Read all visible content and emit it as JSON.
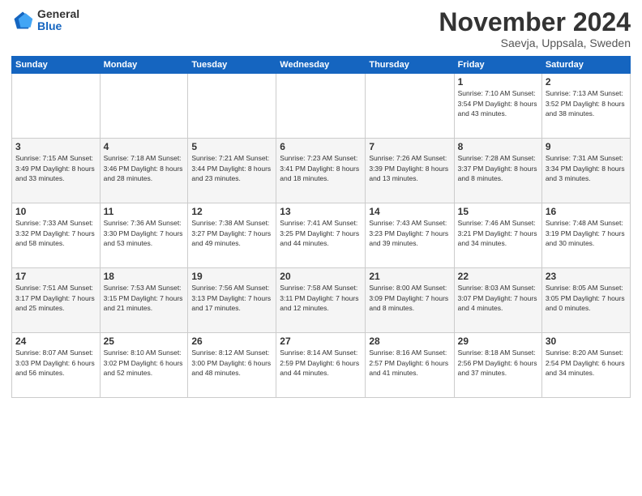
{
  "header": {
    "logo_general": "General",
    "logo_blue": "Blue",
    "month_title": "November 2024",
    "subtitle": "Saevja, Uppsala, Sweden"
  },
  "days_of_week": [
    "Sunday",
    "Monday",
    "Tuesday",
    "Wednesday",
    "Thursday",
    "Friday",
    "Saturday"
  ],
  "weeks": [
    [
      {
        "day": "",
        "info": ""
      },
      {
        "day": "",
        "info": ""
      },
      {
        "day": "",
        "info": ""
      },
      {
        "day": "",
        "info": ""
      },
      {
        "day": "",
        "info": ""
      },
      {
        "day": "1",
        "info": "Sunrise: 7:10 AM\nSunset: 3:54 PM\nDaylight: 8 hours\nand 43 minutes."
      },
      {
        "day": "2",
        "info": "Sunrise: 7:13 AM\nSunset: 3:52 PM\nDaylight: 8 hours\nand 38 minutes."
      }
    ],
    [
      {
        "day": "3",
        "info": "Sunrise: 7:15 AM\nSunset: 3:49 PM\nDaylight: 8 hours\nand 33 minutes."
      },
      {
        "day": "4",
        "info": "Sunrise: 7:18 AM\nSunset: 3:46 PM\nDaylight: 8 hours\nand 28 minutes."
      },
      {
        "day": "5",
        "info": "Sunrise: 7:21 AM\nSunset: 3:44 PM\nDaylight: 8 hours\nand 23 minutes."
      },
      {
        "day": "6",
        "info": "Sunrise: 7:23 AM\nSunset: 3:41 PM\nDaylight: 8 hours\nand 18 minutes."
      },
      {
        "day": "7",
        "info": "Sunrise: 7:26 AM\nSunset: 3:39 PM\nDaylight: 8 hours\nand 13 minutes."
      },
      {
        "day": "8",
        "info": "Sunrise: 7:28 AM\nSunset: 3:37 PM\nDaylight: 8 hours\nand 8 minutes."
      },
      {
        "day": "9",
        "info": "Sunrise: 7:31 AM\nSunset: 3:34 PM\nDaylight: 8 hours\nand 3 minutes."
      }
    ],
    [
      {
        "day": "10",
        "info": "Sunrise: 7:33 AM\nSunset: 3:32 PM\nDaylight: 7 hours\nand 58 minutes."
      },
      {
        "day": "11",
        "info": "Sunrise: 7:36 AM\nSunset: 3:30 PM\nDaylight: 7 hours\nand 53 minutes."
      },
      {
        "day": "12",
        "info": "Sunrise: 7:38 AM\nSunset: 3:27 PM\nDaylight: 7 hours\nand 49 minutes."
      },
      {
        "day": "13",
        "info": "Sunrise: 7:41 AM\nSunset: 3:25 PM\nDaylight: 7 hours\nand 44 minutes."
      },
      {
        "day": "14",
        "info": "Sunrise: 7:43 AM\nSunset: 3:23 PM\nDaylight: 7 hours\nand 39 minutes."
      },
      {
        "day": "15",
        "info": "Sunrise: 7:46 AM\nSunset: 3:21 PM\nDaylight: 7 hours\nand 34 minutes."
      },
      {
        "day": "16",
        "info": "Sunrise: 7:48 AM\nSunset: 3:19 PM\nDaylight: 7 hours\nand 30 minutes."
      }
    ],
    [
      {
        "day": "17",
        "info": "Sunrise: 7:51 AM\nSunset: 3:17 PM\nDaylight: 7 hours\nand 25 minutes."
      },
      {
        "day": "18",
        "info": "Sunrise: 7:53 AM\nSunset: 3:15 PM\nDaylight: 7 hours\nand 21 minutes."
      },
      {
        "day": "19",
        "info": "Sunrise: 7:56 AM\nSunset: 3:13 PM\nDaylight: 7 hours\nand 17 minutes."
      },
      {
        "day": "20",
        "info": "Sunrise: 7:58 AM\nSunset: 3:11 PM\nDaylight: 7 hours\nand 12 minutes."
      },
      {
        "day": "21",
        "info": "Sunrise: 8:00 AM\nSunset: 3:09 PM\nDaylight: 7 hours\nand 8 minutes."
      },
      {
        "day": "22",
        "info": "Sunrise: 8:03 AM\nSunset: 3:07 PM\nDaylight: 7 hours\nand 4 minutes."
      },
      {
        "day": "23",
        "info": "Sunrise: 8:05 AM\nSunset: 3:05 PM\nDaylight: 7 hours\nand 0 minutes."
      }
    ],
    [
      {
        "day": "24",
        "info": "Sunrise: 8:07 AM\nSunset: 3:03 PM\nDaylight: 6 hours\nand 56 minutes."
      },
      {
        "day": "25",
        "info": "Sunrise: 8:10 AM\nSunset: 3:02 PM\nDaylight: 6 hours\nand 52 minutes."
      },
      {
        "day": "26",
        "info": "Sunrise: 8:12 AM\nSunset: 3:00 PM\nDaylight: 6 hours\nand 48 minutes."
      },
      {
        "day": "27",
        "info": "Sunrise: 8:14 AM\nSunset: 2:59 PM\nDaylight: 6 hours\nand 44 minutes."
      },
      {
        "day": "28",
        "info": "Sunrise: 8:16 AM\nSunset: 2:57 PM\nDaylight: 6 hours\nand 41 minutes."
      },
      {
        "day": "29",
        "info": "Sunrise: 8:18 AM\nSunset: 2:56 PM\nDaylight: 6 hours\nand 37 minutes."
      },
      {
        "day": "30",
        "info": "Sunrise: 8:20 AM\nSunset: 2:54 PM\nDaylight: 6 hours\nand 34 minutes."
      }
    ]
  ]
}
